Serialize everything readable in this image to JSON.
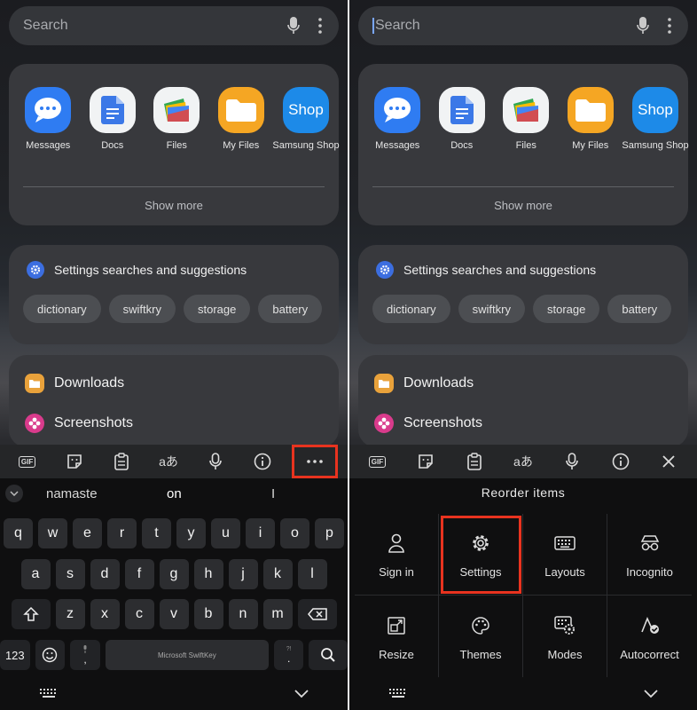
{
  "search": {
    "placeholder": "Search"
  },
  "apps": [
    {
      "label": "Messages",
      "icon": "messages-icon",
      "color": "#2f7cf2"
    },
    {
      "label": "Docs",
      "icon": "docs-icon",
      "color": "#f1f3f4"
    },
    {
      "label": "Files",
      "icon": "files-icon",
      "color": "#f1f3f4"
    },
    {
      "label": "My Files",
      "icon": "my-files-icon",
      "color": "#f5a623"
    },
    {
      "label": "Samsung Shop",
      "icon": "samsung-shop-icon",
      "color": "#1d8ae8",
      "text": "Shop"
    }
  ],
  "show_more": "Show more",
  "suggestions": {
    "title": "Settings searches and suggestions",
    "chips": [
      "dictionary",
      "swiftkry",
      "storage",
      "battery"
    ]
  },
  "files": [
    {
      "label": "Downloads",
      "icon": "folder-icon",
      "color": "#e9a23b"
    },
    {
      "label": "Screenshots",
      "icon": "flower-icon",
      "color": "#d93b8c"
    }
  ],
  "toolbar": {
    "gif": "GIF",
    "translate": "aあ"
  },
  "predictions": [
    "namaste",
    "on",
    "I"
  ],
  "keys": {
    "row1": [
      "q",
      "w",
      "e",
      "r",
      "t",
      "y",
      "u",
      "i",
      "o",
      "p"
    ],
    "row2": [
      "a",
      "s",
      "d",
      "f",
      "g",
      "h",
      "j",
      "k",
      "l"
    ],
    "row3": [
      "z",
      "x",
      "c",
      "v",
      "b",
      "n",
      "m"
    ],
    "num": "123",
    "space": "Microsoft SwiftKey",
    "comma": ",",
    "period": "."
  },
  "menu": {
    "title": "Reorder items",
    "items": [
      "Sign in",
      "Settings",
      "Layouts",
      "Incognito",
      "Resize",
      "Themes",
      "Modes",
      "Autocorrect"
    ]
  }
}
